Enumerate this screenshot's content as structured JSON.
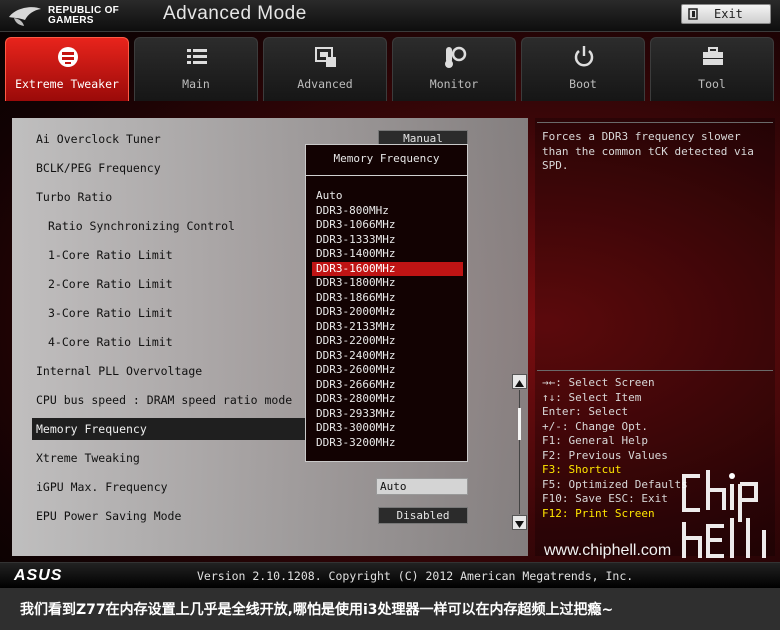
{
  "header": {
    "brand_line1": "REPUBLIC OF",
    "brand_line2": "GAMERS",
    "mode_title": "Advanced Mode",
    "exit_label": "Exit"
  },
  "tabs": [
    {
      "label": "Extreme Tweaker",
      "icon": "fan-icon",
      "active": true
    },
    {
      "label": "Main",
      "icon": "list-icon",
      "active": false
    },
    {
      "label": "Advanced",
      "icon": "chip-icon",
      "active": false
    },
    {
      "label": "Monitor",
      "icon": "gauge-icon",
      "active": false
    },
    {
      "label": "Boot",
      "icon": "power-icon",
      "active": false
    },
    {
      "label": "Tool",
      "icon": "toolbox-icon",
      "active": false
    }
  ],
  "settings": [
    {
      "label": "Ai Overclock Tuner",
      "value": "Manual"
    },
    {
      "label": "BCLK/PEG Frequency",
      "value": ""
    },
    {
      "label": "Turbo Ratio",
      "value": ""
    },
    {
      "label": "Ratio Synchronizing Control",
      "value": ""
    },
    {
      "label": "1-Core Ratio Limit",
      "value": ""
    },
    {
      "label": "2-Core Ratio Limit",
      "value": ""
    },
    {
      "label": "3-Core Ratio Limit",
      "value": ""
    },
    {
      "label": "4-Core Ratio Limit",
      "value": ""
    },
    {
      "label": "Internal PLL Overvoltage",
      "value": ""
    },
    {
      "label": "CPU bus speed : DRAM speed ratio mode",
      "value": ""
    },
    {
      "label": "Memory Frequency",
      "value": ""
    },
    {
      "label": "Xtreme Tweaking",
      "value": ""
    },
    {
      "label": "iGPU Max. Frequency",
      "value": "Auto"
    },
    {
      "label": "EPU Power Saving Mode",
      "value": "Disabled"
    }
  ],
  "dropdown": {
    "title": "Memory Frequency",
    "options": [
      "Auto",
      "DDR3-800MHz",
      "DDR3-1066MHz",
      "DDR3-1333MHz",
      "DDR3-1400MHz",
      "DDR3-1600MHz",
      "DDR3-1800MHz",
      "DDR3-1866MHz",
      "DDR3-2000MHz",
      "DDR3-2133MHz",
      "DDR3-2200MHz",
      "DDR3-2400MHz",
      "DDR3-2600MHz",
      "DDR3-2666MHz",
      "DDR3-2800MHz",
      "DDR3-2933MHz",
      "DDR3-3000MHz",
      "DDR3-3200MHz"
    ],
    "selected": "DDR3-1600MHz"
  },
  "help": {
    "description": "Forces a DDR3 frequency slower than the common tCK detected via SPD.",
    "keys": [
      {
        "text": "→←: Select Screen",
        "highlight": false
      },
      {
        "text": "↑↓: Select Item",
        "highlight": false
      },
      {
        "text": "Enter: Select",
        "highlight": false
      },
      {
        "text": "+/-: Change Opt.",
        "highlight": false
      },
      {
        "text": "F1: General Help",
        "highlight": false
      },
      {
        "text": "F2: Previous Values",
        "highlight": false
      },
      {
        "text": "F3: Shortcut",
        "highlight": true
      },
      {
        "text": "F5: Optimized Defaults",
        "highlight": false
      },
      {
        "text": "F10: Save  ESC: Exit",
        "highlight": false
      },
      {
        "text": "F12: Print Screen",
        "highlight": true
      }
    ]
  },
  "watermark": {
    "site": "www.chiphell.com"
  },
  "footer": {
    "logo": "ASUS",
    "version": "Version 2.10.1208. Copyright (C) 2012 American Megatrends, Inc."
  },
  "caption": "我们看到Z77在内存设置上几乎是全线开放,哪怕是使用i3处理器一样可以在内存超频上过把瘾~",
  "colors": {
    "accent": "#c4140f",
    "highlight_key": "#ffe600",
    "selected_option": "#bf1414"
  }
}
